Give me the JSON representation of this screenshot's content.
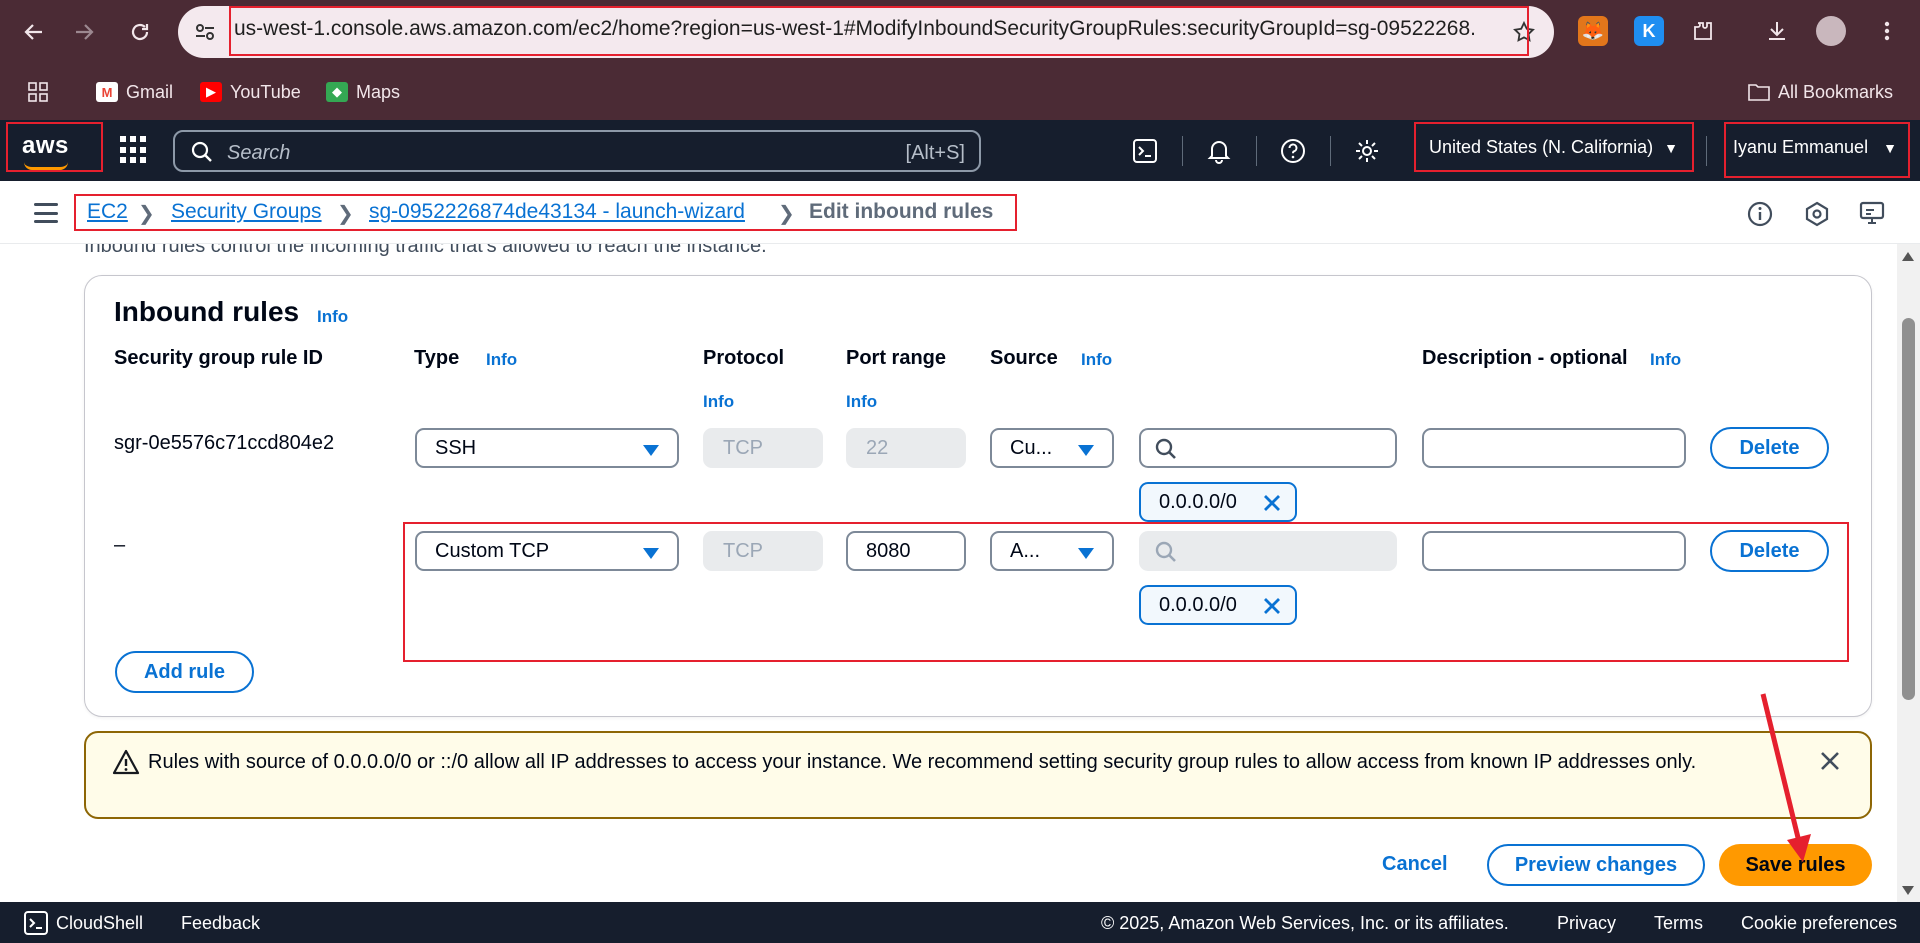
{
  "browser": {
    "url": "us-west-1.console.aws.amazon.com/ec2/home?region=us-west-1#ModifyInboundSecurityGroupRules:securityGroupId=sg-09522268...",
    "bookmarks": [
      {
        "label": "Gmail",
        "icon": "gmail-icon"
      },
      {
        "label": "YouTube",
        "icon": "youtube-icon"
      },
      {
        "label": "Maps",
        "icon": "maps-icon"
      }
    ],
    "all_bookmarks": "All Bookmarks"
  },
  "aws_nav": {
    "logo": "aws",
    "search_placeholder": "Search",
    "search_shortcut": "[Alt+S]",
    "region": "United States (N. California)",
    "user": "Iyanu Emmanuel"
  },
  "breadcrumb": {
    "items": [
      "EC2",
      "Security Groups",
      "sg-0952226874de43134 - launch-wizard"
    ],
    "current": "Edit inbound rules"
  },
  "intro_text": "Inbound rules control the incoming traffic that's allowed to reach the instance.",
  "inbound": {
    "title": "Inbound rules",
    "info": "Info",
    "columns": {
      "rule_id": "Security group rule ID",
      "type": "Type",
      "protocol": "Protocol",
      "port_range": "Port range",
      "source": "Source",
      "description": "Description - optional"
    },
    "rules": [
      {
        "rule_id": "sgr-0e5576c71ccd804e2",
        "type": "SSH",
        "protocol": "TCP",
        "port": "22",
        "source": "Cu...",
        "cidr": "0.0.0.0/0",
        "delete": "Delete"
      },
      {
        "rule_id": "–",
        "type": "Custom TCP",
        "protocol": "TCP",
        "port": "8080",
        "source": "A...",
        "cidr": "0.0.0.0/0",
        "delete": "Delete"
      }
    ],
    "add_rule": "Add rule"
  },
  "alert": {
    "text": "Rules with source of 0.0.0.0/0 or ::/0 allow all IP addresses to access your instance. We recommend setting security group rules to allow access from known IP addresses only."
  },
  "actions": {
    "cancel": "Cancel",
    "preview": "Preview changes",
    "save": "Save rules"
  },
  "footer": {
    "cloudshell": "CloudShell",
    "feedback": "Feedback",
    "copyright": "© 2025, Amazon Web Services, Inc. or its affiliates.",
    "privacy": "Privacy",
    "terms": "Terms",
    "cookies": "Cookie preferences"
  },
  "colors": {
    "accent": "#0972d3",
    "primary_button": "#ff9900",
    "nav_bg": "#161e2d",
    "browser_bg": "#4b2b35",
    "annotation": "#e5202e"
  }
}
